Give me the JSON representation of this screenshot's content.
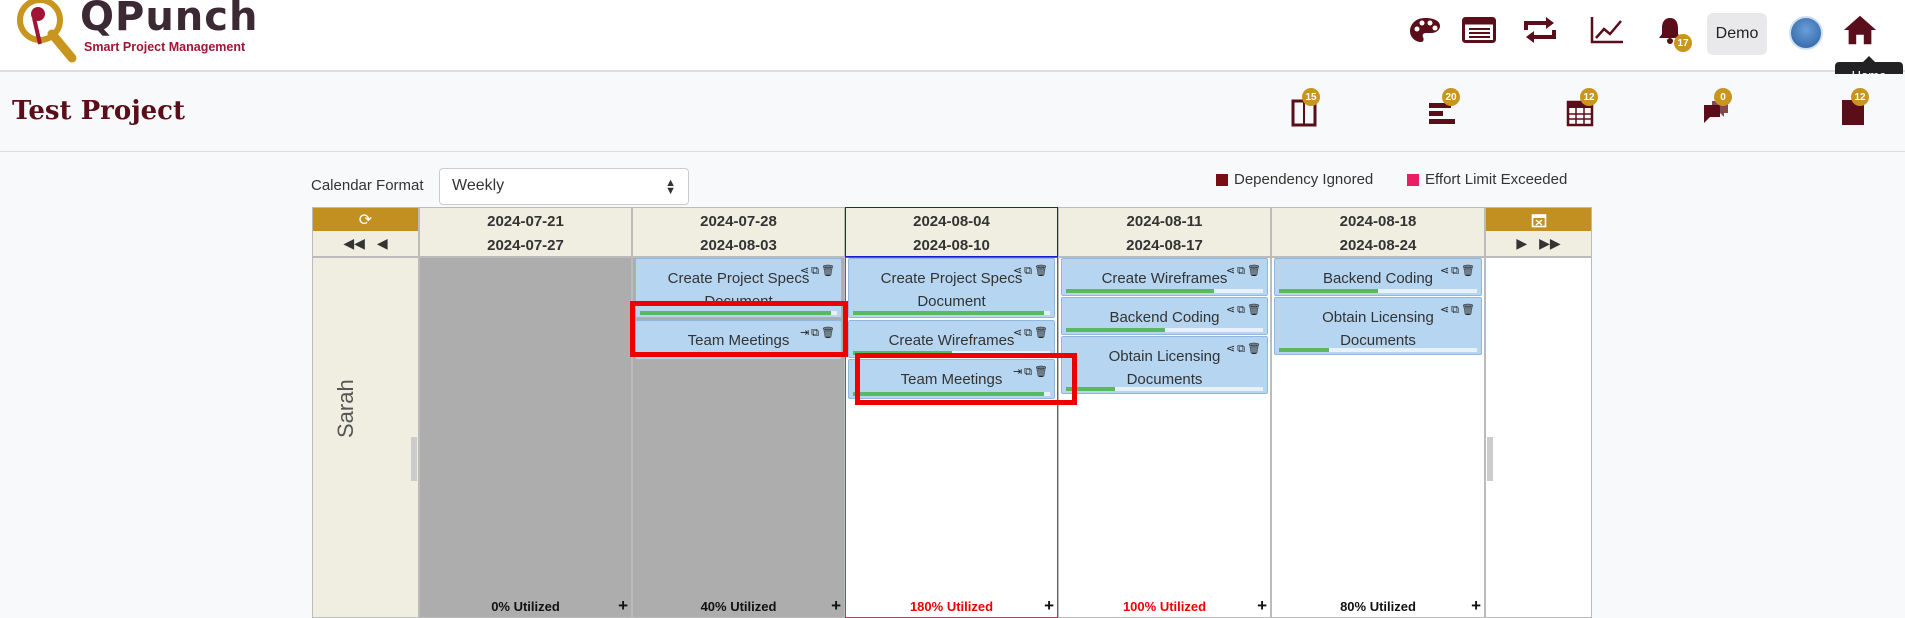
{
  "app": {
    "logo_name": "QPunch",
    "logo_tagline": "Smart Project Management"
  },
  "header": {
    "demo_label": "Demo",
    "notification_count": "17",
    "tooltip": "Home"
  },
  "project": {
    "title": "Test Project",
    "toolbar_badges": [
      "15",
      "20",
      "12",
      "0",
      "12"
    ]
  },
  "controls": {
    "calendar_format_label": "Calendar Format",
    "calendar_format_value": "Weekly",
    "legend": [
      {
        "label": "Dependency Ignored",
        "color": "#7a0d14"
      },
      {
        "label": "Effort Limit Exceeded",
        "color": "#e91e63"
      }
    ]
  },
  "calendar": {
    "resource": "Sarah",
    "weeks": [
      {
        "start": "2024-07-21",
        "end": "2024-07-27",
        "utilization": "0% Utilized",
        "over": false,
        "tasks": []
      },
      {
        "start": "2024-07-28",
        "end": "2024-08-03",
        "utilization": "40% Utilized",
        "over": false,
        "tasks": [
          {
            "title": "Create Project Specs Document",
            "progress": 0.97
          },
          {
            "title": "Team Meetings",
            "progress": 0.97
          }
        ]
      },
      {
        "start": "2024-08-04",
        "end": "2024-08-10",
        "utilization": "180% Utilized",
        "over": true,
        "tasks": [
          {
            "title": "Create Project Specs Document",
            "progress": 0.97
          },
          {
            "title": "Create Wireframes",
            "progress": 0.5
          },
          {
            "title": "Team Meetings",
            "progress": 0.97
          }
        ]
      },
      {
        "start": "2024-08-11",
        "end": "2024-08-17",
        "utilization": "100% Utilized",
        "over": true,
        "tasks": [
          {
            "title": "Create Wireframes",
            "progress": 0.75
          },
          {
            "title": "Backend Coding",
            "progress": 0.5
          },
          {
            "title": "Obtain Licensing Documents",
            "progress": 0.25
          }
        ]
      },
      {
        "start": "2024-08-18",
        "end": "2024-08-24",
        "utilization": "80% Utilized",
        "over": false,
        "tasks": [
          {
            "title": "Backend Coding",
            "progress": 0.5
          },
          {
            "title": "Obtain Licensing Documents",
            "progress": 0.25
          }
        ]
      }
    ]
  }
}
